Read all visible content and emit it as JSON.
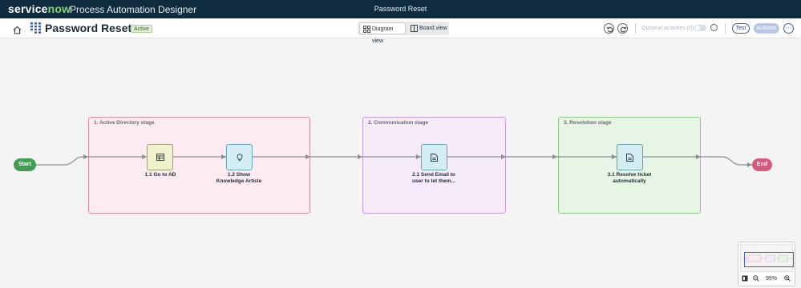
{
  "topbar": {
    "logo_text": "servicenow",
    "logo_part_a": "service",
    "logo_part_b": "now",
    "app_name": "Process Automation Designer",
    "center_title": "Password Reset"
  },
  "toolbar": {
    "flow_name": "Password Reset",
    "status": "Active",
    "views": {
      "diagram": "Diagram view",
      "board": "Board view"
    },
    "optional_activities": "Optional activities (0)",
    "test_label": "Test",
    "activate_label": "Activate",
    "more_label": "···"
  },
  "diagram": {
    "start_label": "Start",
    "end_label": "End",
    "stages": [
      {
        "title": "1. Active Directory stage",
        "color": "#e38ea8"
      },
      {
        "title": "2. Communication stage",
        "color": "#c79ae1"
      },
      {
        "title": "3. Resolution stage",
        "color": "#8ec98a"
      }
    ],
    "activities": [
      {
        "label": "1.1 Go to AD",
        "icon": "table-icon",
        "color": "#f0f2cc"
      },
      {
        "label": "1.2 Show Knowledge Article",
        "label_line1": "1.2 Show",
        "label_line2": "Knowledge Article",
        "icon": "lightbulb-icon",
        "color": "#d3eef3"
      },
      {
        "label": "2.1 Send Email to user to let them...",
        "label_line1": "2.1 Send Email to",
        "label_line2": "user to let them...",
        "icon": "document-icon",
        "color": "#d3eef3"
      },
      {
        "label": "3.1 Resolve ticket automatically",
        "label_line1": "3.1 Resolve ticket",
        "label_line2": "automatically",
        "icon": "document-icon",
        "color": "#d3eef3"
      }
    ]
  },
  "minimap": {
    "zoom": "95%"
  },
  "colors": {
    "nav_bg": "#0f2c3e",
    "brand_green": "#81d36e",
    "start": "#3f9e52",
    "end": "#d8577c",
    "accent": "#3b5ea8"
  }
}
